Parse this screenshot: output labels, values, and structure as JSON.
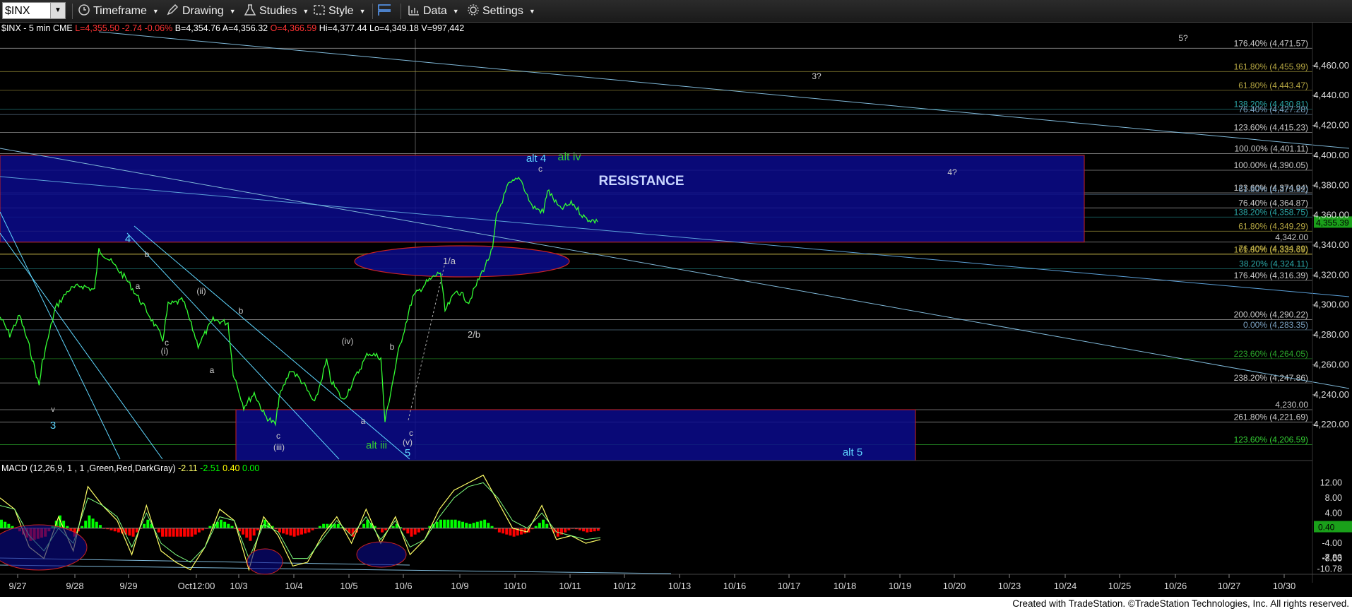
{
  "toolbar": {
    "symbol": "$INX",
    "timeframe": "Timeframe",
    "drawing": "Drawing",
    "studies": "Studies",
    "style": "Style",
    "data": "Data",
    "settings": "Settings"
  },
  "legend": {
    "symbol": "$INX - 5 min",
    "exchange": "CME",
    "last": "L=4,355.50",
    "change": "-2.74",
    "change_pct": "-0.06%",
    "bid": "B=4,354.76",
    "ask": "A=4,356.32",
    "open": "O=4,366.59",
    "high": "Hi=4,377.44",
    "low": "Lo=4,349.18",
    "volume": "V=997,442"
  },
  "macd_legend": {
    "name": "MACD (12,26,9, 1 , 1 ,Green,Red,DarkGray)",
    "v1": "-2.11",
    "v2": "-2.51",
    "v3": "0.40",
    "v4": "0.00"
  },
  "footer": "Created with TradeStation. ©TradeStation Technologies, Inc. All rights reserved.",
  "colors": {
    "price": "#33ff33",
    "zone": "#0a0a8c",
    "cyan": "#5fd7ff",
    "green_label": "#33cc33",
    "macd_up": "#00ff00",
    "macd_down": "#ff0000"
  },
  "chart_data": [
    {
      "type": "line",
      "series": [
        {
          "name": "$INX - 5 min",
          "points": [
            [
              "9/27 09:30",
              4292
            ],
            [
              "9/27 11:00",
              4280
            ],
            [
              "9/27 12:30",
              4293
            ],
            [
              "9/27 14:00",
              4272
            ],
            [
              "9/27 15:30",
              4246
            ],
            [
              "9/28 09:30",
              4262
            ],
            [
              "9/28 11:00",
              4298
            ],
            [
              "9/28 12:30",
              4310
            ],
            [
              "9/28 14:00",
              4313
            ],
            [
              "9/28 15:30",
              4310
            ],
            [
              "9/29 09:30",
              4337
            ],
            [
              "9/29 10:30",
              4330
            ],
            [
              "9/29 12:00",
              4318
            ],
            [
              "9/29 14:00",
              4296
            ],
            [
              "9/29 15:30",
              4277
            ],
            [
              "Oct12:00 09:30",
              4300
            ],
            [
              "Oct12:00 11:00",
              4303
            ],
            [
              "Oct12:00 12:30",
              4273
            ],
            [
              "Oct12:00 14:00",
              4290
            ],
            [
              "Oct12:00 15:30",
              4288
            ],
            [
              "10/3 09:30",
              4255
            ],
            [
              "10/3 11:00",
              4232
            ],
            [
              "10/3 12:30",
              4241
            ],
            [
              "10/3 14:00",
              4226
            ],
            [
              "10/3 15:30",
              4220
            ],
            [
              "10/4 09:30",
              4238
            ],
            [
              "10/4 11:00",
              4257
            ],
            [
              "10/4 12:30",
              4248
            ],
            [
              "10/4 14:00",
              4234
            ],
            [
              "10/4 15:30",
              4263
            ],
            [
              "10/5 09:30",
              4250
            ],
            [
              "10/5 11:00",
              4236
            ],
            [
              "10/5 12:30",
              4252
            ],
            [
              "10/5 14:00",
              4268
            ],
            [
              "10/5 15:30",
              4265
            ],
            [
              "10/6 09:30",
              4222
            ],
            [
              "10/6 11:00",
              4270
            ],
            [
              "10/6 12:30",
              4305
            ],
            [
              "10/6 14:00",
              4315
            ],
            [
              "10/6 15:30",
              4322
            ],
            [
              "10/9 09:30",
              4296
            ],
            [
              "10/9 11:00",
              4310
            ],
            [
              "10/9 12:30",
              4302
            ],
            [
              "10/9 14:00",
              4320
            ],
            [
              "10/9 15:30",
              4337
            ],
            [
              "10/10 09:30",
              4360
            ],
            [
              "10/10 11:00",
              4380
            ],
            [
              "10/10 12:30",
              4385
            ],
            [
              "10/10 14:00",
              4366
            ],
            [
              "10/10 15:30",
              4362
            ],
            [
              "10/11 09:30",
              4377
            ],
            [
              "10/11 11:00",
              4364
            ],
            [
              "10/11 12:30",
              4368
            ],
            [
              "10/11 14:00",
              4358
            ],
            [
              "10/11 15:30",
              4355.5
            ]
          ]
        },
        {
          "name": "MACD",
          "values": [
            8,
            5,
            -5,
            -8,
            3,
            -6,
            11,
            6,
            2,
            -7,
            6,
            -6,
            -9,
            -11,
            -5,
            5,
            2,
            -11,
            3,
            -2,
            -10,
            -9,
            -2,
            3,
            -4,
            5,
            -4,
            3,
            -7,
            -3,
            5,
            10,
            12,
            14,
            7,
            0,
            -1,
            6,
            -3,
            -2,
            -4,
            -3
          ]
        },
        {
          "name": "Signal",
          "values": [
            6,
            5,
            -2,
            -6,
            0,
            -4,
            8,
            6,
            3,
            -5,
            4,
            -4,
            -7,
            -9,
            -5,
            3,
            2,
            -8,
            1,
            -1,
            -8,
            -8,
            -3,
            2,
            -2,
            3,
            -3,
            2,
            -5,
            -3,
            3,
            8,
            11,
            12,
            8,
            2,
            0,
            4,
            -1,
            -2,
            -3,
            -2.5
          ]
        }
      ],
      "x_tick_labels": [
        "9/27",
        "9/28",
        "9/29",
        "Oct12:00",
        "10/3",
        "10/4",
        "10/5",
        "10/6",
        "10/9",
        "10/10",
        "10/11",
        "10/12",
        "10/13",
        "10/16",
        "10/17",
        "10/18",
        "10/19",
        "10/20",
        "10/23",
        "10/24",
        "10/25",
        "10/26",
        "10/27",
        "10/30"
      ],
      "y_tick_labels": [
        "4,220.00",
        "4,240.00",
        "4,260.00",
        "4,280.00",
        "4,300.00",
        "4,320.00",
        "4,340.00",
        "4,360.00",
        "4,380.00",
        "4,400.00",
        "4,420.00",
        "4,440.00",
        "4,460.00"
      ],
      "ylim": [
        4196,
        4484
      ],
      "last_price_label": "4,355.39",
      "fib_levels": [
        {
          "label": "176.40% (4,471.57)",
          "value": 4471.57
        },
        {
          "label": "161.80% (4,455.99)",
          "value": 4455.99
        },
        {
          "label": "61.80% (4,443.47)",
          "value": 4443.47
        },
        {
          "label": "138.20% (4,430.81)",
          "value": 4430.81
        },
        {
          "label": "76.40% (4,427.28)",
          "value": 4427.28
        },
        {
          "label": "123.60% (4,415.23)",
          "value": 4415.23
        },
        {
          "label": "100.00% (4,401.11)",
          "value": 4401.11
        },
        {
          "label": "100.00% (4,390.05)",
          "value": 4390.05
        },
        {
          "label": "123.60% (4,374.94)",
          "value": 4374.94
        },
        {
          "label": "61.80% (4,373.92)",
          "value": 4373.92
        },
        {
          "label": "76.40% (4,364.87)",
          "value": 4364.87
        },
        {
          "label": "138.20% (4,358.75)",
          "value": 4358.75
        },
        {
          "label": "61.80% (4,349.29)",
          "value": 4349.29
        },
        {
          "label": "4,342.00",
          "value": 4342.0
        },
        {
          "label": "76.40% (4,334.39)",
          "value": 4334.39
        },
        {
          "label": "161.80% (4,333.69)",
          "value": 4333.69
        },
        {
          "label": "38.20% (4,324.11)",
          "value": 4324.11
        },
        {
          "label": "176.40% (4,316.39)",
          "value": 4316.39
        },
        {
          "label": "200.00% (4,290.22)",
          "value": 4290.22
        },
        {
          "label": "0.00% (4,283.35)",
          "value": 4283.35
        },
        {
          "label": "223.60% (4,264.05)",
          "value": 4264.05
        },
        {
          "label": "238.20% (4,247.86)",
          "value": 4247.86
        },
        {
          "label": "4,230.00",
          "value": 4230.0
        },
        {
          "label": "261.80% (4,221.69)",
          "value": 4221.69
        },
        {
          "label": "123.60% (4,206.59)",
          "value": 4206.59
        }
      ],
      "zones": [
        {
          "name": "resistance",
          "label": "RESISTANCE",
          "low": 4342,
          "high": 4400
        },
        {
          "name": "support",
          "label": "",
          "low": 4196,
          "high": 4230
        }
      ],
      "annotations": [
        "3",
        "4",
        "5",
        "alt 4",
        "alt iv",
        "alt iii",
        "alt 5",
        "1/a",
        "2/b",
        "3?",
        "4?",
        "5?",
        "a",
        "b",
        "c",
        "(i)",
        "(ii)",
        "(iii)",
        "(iv)",
        "(v)"
      ],
      "macd_y_tick_labels": [
        "12.00",
        "8.00",
        "4.00",
        "0.40",
        "-4.00",
        "-7.83",
        "-8.00",
        "-10.78"
      ]
    }
  ]
}
